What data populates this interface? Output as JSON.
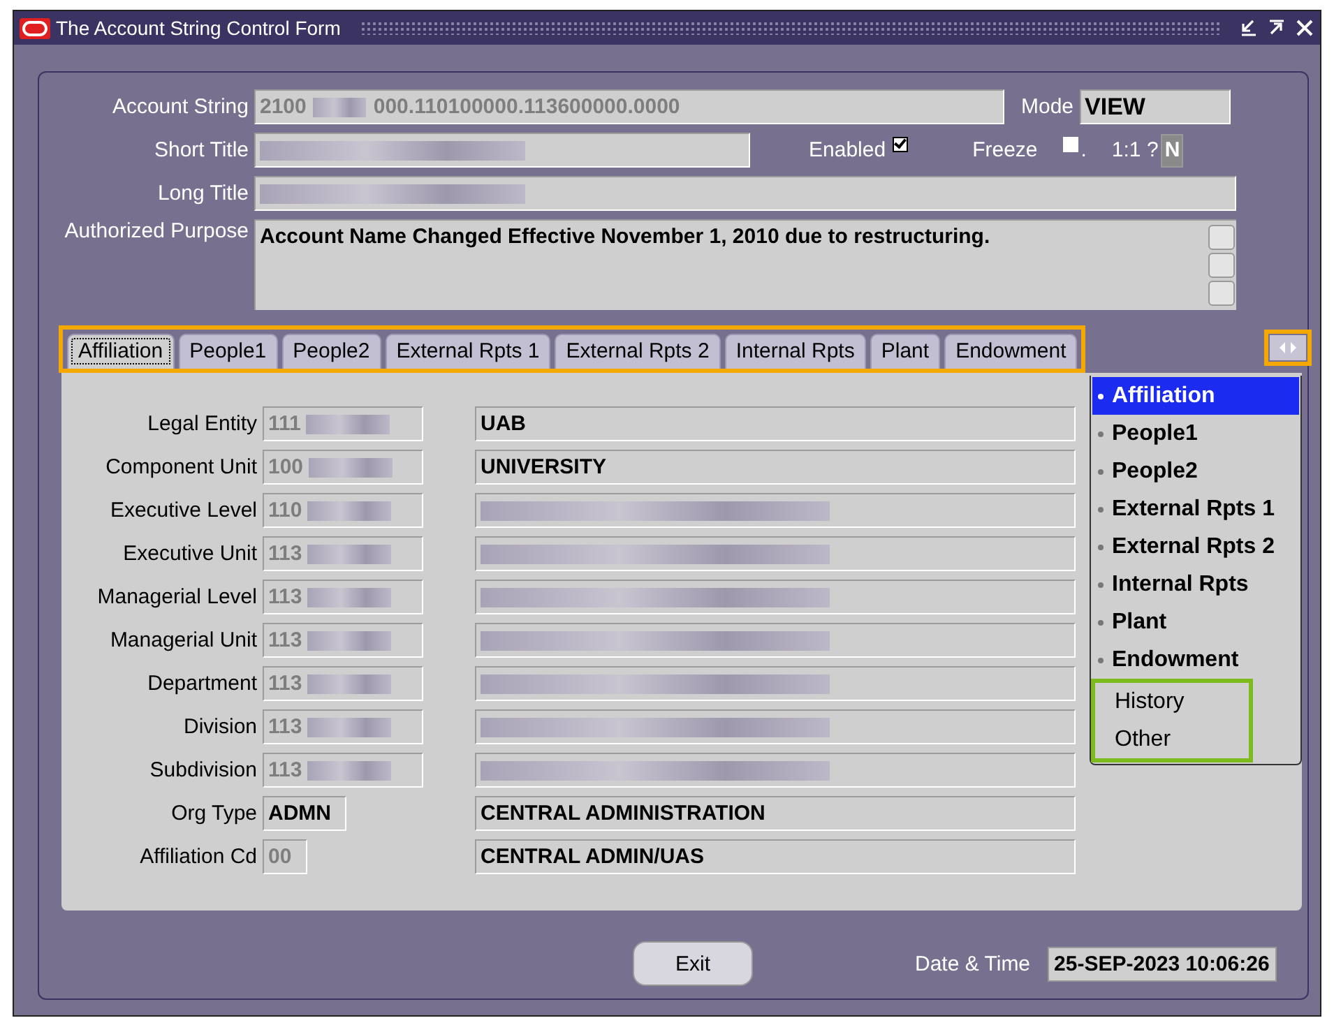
{
  "window": {
    "title": "The Account String Control Form"
  },
  "header": {
    "account_string": {
      "label": "Account String",
      "value": "2100",
      "redacted": true,
      "value_end": "000.110100000.113600000.0000"
    },
    "mode": {
      "label": "Mode",
      "value": "VIEW"
    },
    "short_title": {
      "label": "Short Title",
      "redacted": true
    },
    "enabled": {
      "label": "Enabled",
      "checked": true
    },
    "freeze": {
      "label": "Freeze",
      "checked": false,
      "suffix": "."
    },
    "ratio": {
      "label": "1:1 ?",
      "value": "N"
    },
    "long_title": {
      "label": "Long Title",
      "redacted": true
    },
    "authorized_purpose": {
      "label": "Authorized Purpose",
      "value": "Account Name Changed Effective November 1, 2010 due to restructuring."
    }
  },
  "tabs": {
    "items": [
      {
        "label": "Affiliation",
        "selected": true
      },
      {
        "label": "People1",
        "selected": false
      },
      {
        "label": "People2",
        "selected": false
      },
      {
        "label": "External Rpts 1",
        "selected": false
      },
      {
        "label": "External Rpts 2",
        "selected": false
      },
      {
        "label": "Internal Rpts",
        "selected": false
      },
      {
        "label": "Plant",
        "selected": false
      },
      {
        "label": "Endowment",
        "selected": false
      }
    ]
  },
  "tab_menu": {
    "items": [
      {
        "label": "Affiliation",
        "kind": "tab",
        "selected": true
      },
      {
        "label": "People1",
        "kind": "tab",
        "selected": false
      },
      {
        "label": "People2",
        "kind": "tab",
        "selected": false
      },
      {
        "label": "External Rpts 1",
        "kind": "tab",
        "selected": false
      },
      {
        "label": "External Rpts 2",
        "kind": "tab",
        "selected": false
      },
      {
        "label": "Internal Rpts",
        "kind": "tab",
        "selected": false
      },
      {
        "label": "Plant",
        "kind": "tab",
        "selected": false
      },
      {
        "label": "Endowment",
        "kind": "tab",
        "selected": false
      },
      {
        "label": "History",
        "kind": "action",
        "selected": false
      },
      {
        "label": "Other",
        "kind": "action",
        "selected": false
      }
    ]
  },
  "affiliation_rows": [
    {
      "label": "Legal Entity",
      "code": "111",
      "code_redacted": true,
      "description": "UAB"
    },
    {
      "label": "Component Unit",
      "code": "100",
      "code_redacted": true,
      "description": "UNIVERSITY"
    },
    {
      "label": "Executive Level",
      "code": "110",
      "code_redacted": true,
      "description_redacted": true
    },
    {
      "label": "Executive Unit",
      "code": "113",
      "code_redacted": true,
      "description_redacted": true
    },
    {
      "label": "Managerial Level",
      "code": "113",
      "code_redacted": true,
      "description_redacted": true
    },
    {
      "label": "Managerial Unit",
      "code": "113",
      "code_redacted": true,
      "description_redacted": true
    },
    {
      "label": "Department",
      "code": "113",
      "code_redacted": true,
      "description_redacted": true
    },
    {
      "label": "Division",
      "code": "113",
      "code_redacted": true,
      "description_redacted": true
    },
    {
      "label": "Subdivision",
      "code": "113",
      "code_redacted": true,
      "description_redacted": true
    },
    {
      "label": "Org Type",
      "code": "ADMN",
      "code_bold": true,
      "description": "CENTRAL ADMINISTRATION"
    },
    {
      "label": "Affiliation Cd",
      "code": "00",
      "description": "CENTRAL ADMIN/UAS"
    }
  ],
  "footer": {
    "exit_button": {
      "label": "Exit"
    },
    "date_time": {
      "label": "Date & Time",
      "value": "25-SEP-2023 10:06:26"
    }
  }
}
